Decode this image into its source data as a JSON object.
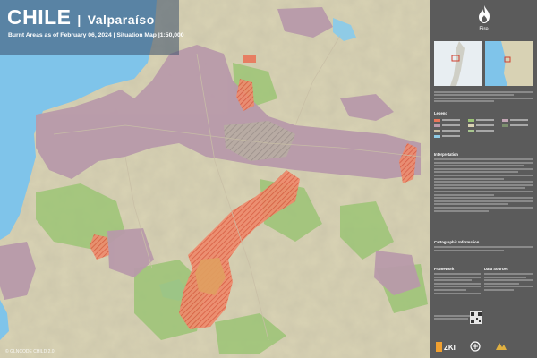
{
  "header": {
    "country": "CHILE",
    "separator": "|",
    "region": "Valparaíso",
    "subtitle": "Burnt Areas as of February 06, 2024 |  Situation Map |1:50,000"
  },
  "map": {
    "copyright": "© GLNCODE CHILD 2.0",
    "icons": [
      "fire-icon"
    ],
    "colors": {
      "sea": "#7fc4ea",
      "terrain": "#d9d3b4",
      "vegetation": "#9cc476",
      "urban": "#b89aaa",
      "burnt": "#e9755a"
    }
  },
  "panel": {
    "category": "Fire",
    "legend_title": "Legend",
    "interpretation_title": "Interpretation",
    "cartographic_title": "Cartographic Information",
    "framework_title": "Framework",
    "data_sources_title": "Data Sources"
  }
}
